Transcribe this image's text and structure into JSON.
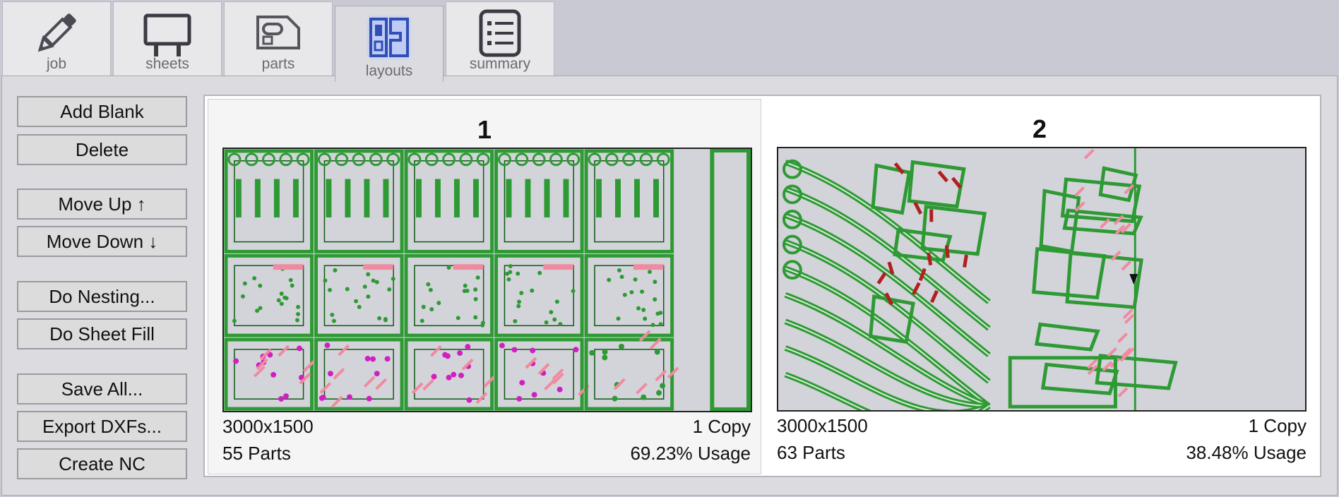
{
  "tabs": [
    {
      "label": "job",
      "icon": "pencil-icon"
    },
    {
      "label": "sheets",
      "icon": "sheet-icon"
    },
    {
      "label": "parts",
      "icon": "part-icon"
    },
    {
      "label": "layouts",
      "icon": "layouts-icon",
      "active": true
    },
    {
      "label": "summary",
      "icon": "list-icon"
    }
  ],
  "buttons": {
    "add_blank": "Add Blank",
    "delete": "Delete",
    "move_up": "Move Up ↑",
    "move_down": "Move Down ↓",
    "do_nesting": "Do Nesting...",
    "do_sheet_fill": "Do Sheet Fill",
    "save_all": "Save All...",
    "export_dxfs": "Export DXFs...",
    "create_nc": "Create NC"
  },
  "layouts": [
    {
      "number": "1",
      "size": "3000x1500",
      "copies": "1 Copy",
      "parts": "55 Parts",
      "usage": "69.23% Usage",
      "usage_fraction": 0.6923
    },
    {
      "number": "2",
      "size": "3000x1500",
      "copies": "1 Copy",
      "parts": "63 Parts",
      "usage": "38.48% Usage",
      "usage_fraction": 0.3848
    }
  ],
  "colors": {
    "accent": "#3b5ccc",
    "part_fill": "#2e9a34",
    "part_stroke": "#0c5a12",
    "sheet": "#d3d3da",
    "marker_pink": "#f08aa0",
    "marker_magenta": "#d020c0",
    "marker_red": "#b02020"
  }
}
